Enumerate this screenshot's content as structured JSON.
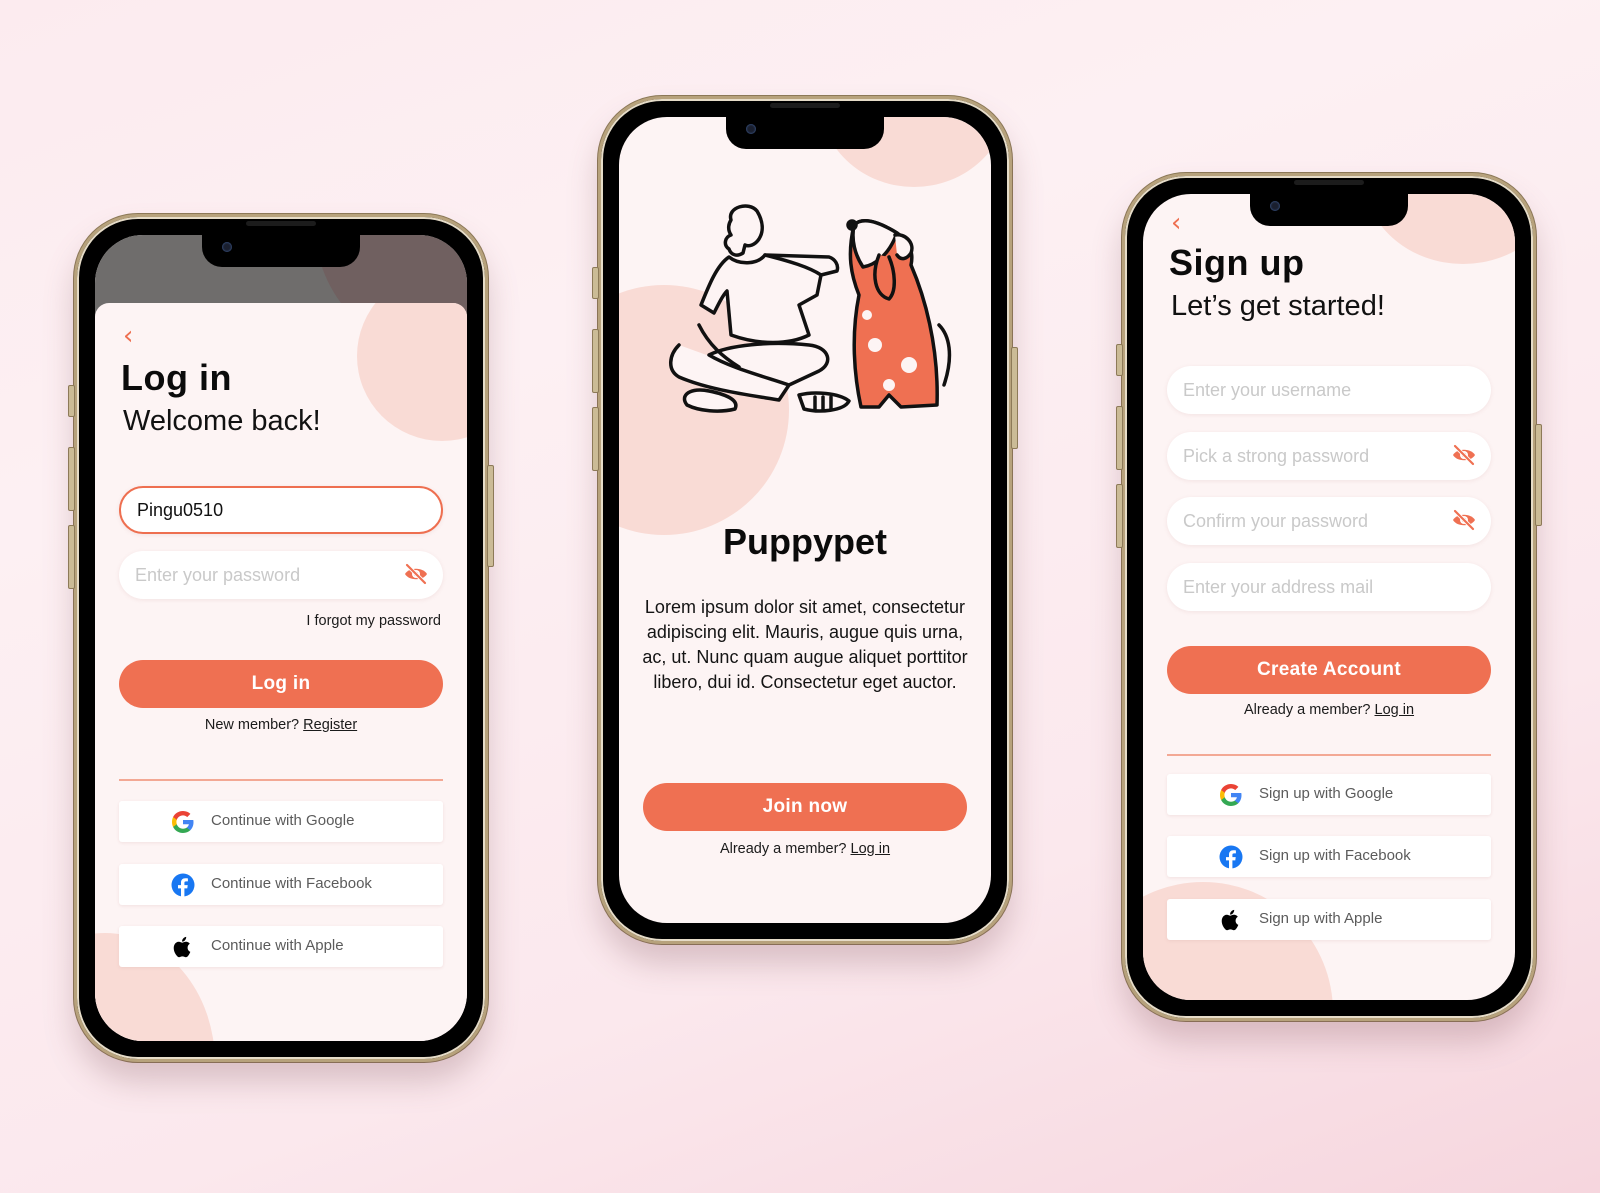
{
  "colors": {
    "accent": "#ef7052",
    "blob": "#f9dbd5",
    "screen_bg": "#fdf4f4",
    "frame_gold": "#b7a27c"
  },
  "login": {
    "back_icon": "chevron-left-icon",
    "title": "Log in",
    "subtitle": "Welcome back!",
    "username_value": "Pingu0510",
    "password_placeholder": "Enter your password",
    "password_toggle_icon": "eye-off-icon",
    "forgot_link": "I forgot my password",
    "submit_label": "Log in",
    "register_prompt": "New member?",
    "register_link": "Register",
    "social": [
      {
        "icon": "google-icon",
        "label": "Continue with Google"
      },
      {
        "icon": "facebook-icon",
        "label": "Continue with Facebook"
      },
      {
        "icon": "apple-icon",
        "label": "Continue with Apple"
      }
    ]
  },
  "welcome": {
    "illustration": "person-petting-dog-illustration",
    "title": "Puppypet",
    "description": "Lorem ipsum dolor sit amet, consectetur adipiscing elit. Mauris, augue quis urna, ac, ut. Nunc quam augue aliquet porttitor libero, dui id. Consectetur eget auctor.",
    "cta_label": "Join now",
    "login_prompt": "Already a member?",
    "login_link": "Log in"
  },
  "signup": {
    "back_icon": "chevron-left-icon",
    "title": "Sign up",
    "subtitle": "Let’s get started!",
    "fields": [
      {
        "placeholder": "Enter your username",
        "toggle": false
      },
      {
        "placeholder": "Pick a strong password",
        "toggle": true
      },
      {
        "placeholder": "Confirm your password",
        "toggle": true
      },
      {
        "placeholder": "Enter your address mail",
        "toggle": false
      }
    ],
    "submit_label": "Create Account",
    "login_prompt": "Already a member?",
    "login_link": "Log in",
    "social": [
      {
        "icon": "google-icon",
        "label": "Sign up with Google"
      },
      {
        "icon": "facebook-icon",
        "label": "Sign up with Facebook"
      },
      {
        "icon": "apple-icon",
        "label": "Sign up with Apple"
      }
    ]
  }
}
